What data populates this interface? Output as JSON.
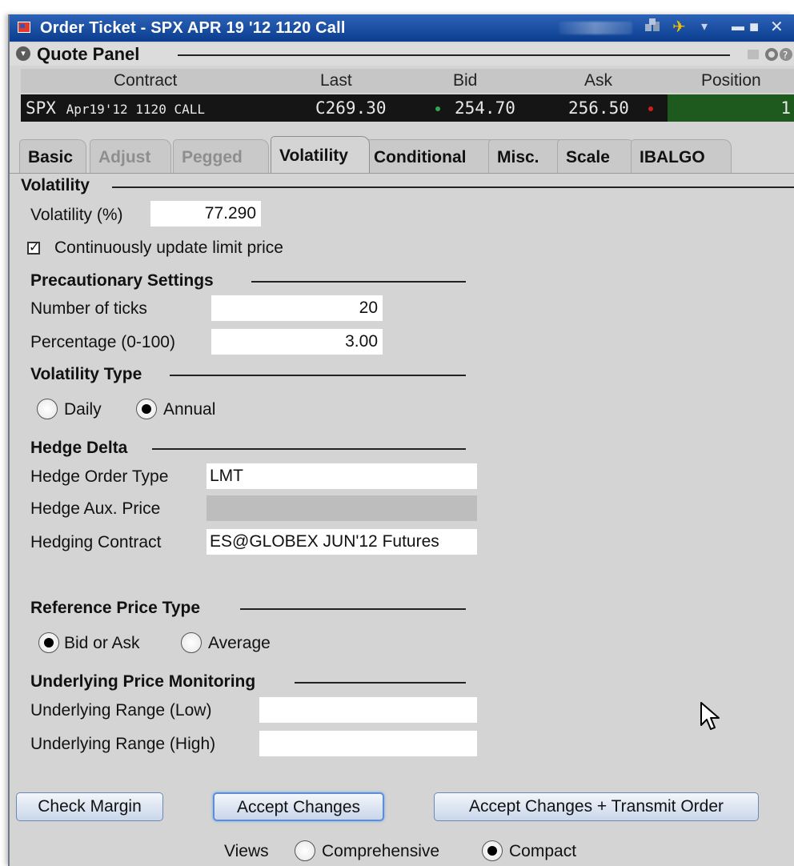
{
  "window": {
    "title": "Order Ticket - SPX APR 19 '12 1120 Call",
    "minimize_glyph": "▬",
    "maximize_glyph": "■",
    "close_glyph": "✕",
    "pin_glyph": "✈",
    "dropdown_glyph": "▾"
  },
  "quote_panel": {
    "title": "Quote Panel",
    "collapse_glyph": "▾",
    "columns": [
      "Contract",
      "Last",
      "Bid",
      "Ask",
      "Position"
    ],
    "row": {
      "contract_symbol": "SPX",
      "contract_detail": "Apr19'12 1120 CALL",
      "last": "C269.30",
      "bid": "254.70",
      "ask": "256.50",
      "position": "1"
    },
    "colors": {
      "row_bg": "#151515",
      "position_bg": "#1e5a1e",
      "bid_dot": "#2fa84f",
      "ask_dot": "#d51a1a"
    }
  },
  "tabs": [
    {
      "label": "Basic",
      "state": "normal"
    },
    {
      "label": "Adjust",
      "state": "disabled"
    },
    {
      "label": "Pegged",
      "state": "disabled"
    },
    {
      "label": "Volatility",
      "state": "active"
    },
    {
      "label": "Conditional",
      "state": "normal"
    },
    {
      "label": "Misc.",
      "state": "normal"
    },
    {
      "label": "Scale",
      "state": "normal"
    },
    {
      "label": "IBALGO",
      "state": "normal"
    }
  ],
  "volatility": {
    "section_title": "Volatility",
    "volatility_label": "Volatility (%)",
    "volatility_value": "77.290",
    "continuous_update_label": "Continuously update limit price",
    "continuous_update_checked": true
  },
  "precautionary": {
    "title": "Precautionary Settings",
    "ticks_label": "Number of ticks",
    "ticks_value": "20",
    "percentage_label": "Percentage (0-100)",
    "percentage_value": "3.00"
  },
  "volatility_type": {
    "title": "Volatility Type",
    "options": [
      "Daily",
      "Annual"
    ],
    "selected": "Annual"
  },
  "hedge_delta": {
    "title": "Hedge Delta",
    "order_type_label": "Hedge Order Type",
    "order_type_value": "LMT",
    "aux_price_label": "Hedge Aux. Price",
    "aux_price_value": "",
    "contract_label": "Hedging Contract",
    "contract_value": "ES@GLOBEX JUN'12 Futures"
  },
  "reference_price": {
    "title": "Reference Price Type",
    "options": [
      "Bid or Ask",
      "Average"
    ],
    "selected": "Bid or Ask"
  },
  "underlying_monitoring": {
    "title": "Underlying Price Monitoring",
    "low_label": "Underlying Range (Low)",
    "low_value": "",
    "high_label": "Underlying Range (High)",
    "high_value": ""
  },
  "buttons": {
    "check_margin": "Check Margin",
    "accept_changes": "Accept Changes",
    "accept_transmit": "Accept Changes + Transmit Order"
  },
  "views": {
    "label": "Views",
    "options": [
      "Comprehensive",
      "Compact"
    ],
    "selected": "Compact"
  }
}
